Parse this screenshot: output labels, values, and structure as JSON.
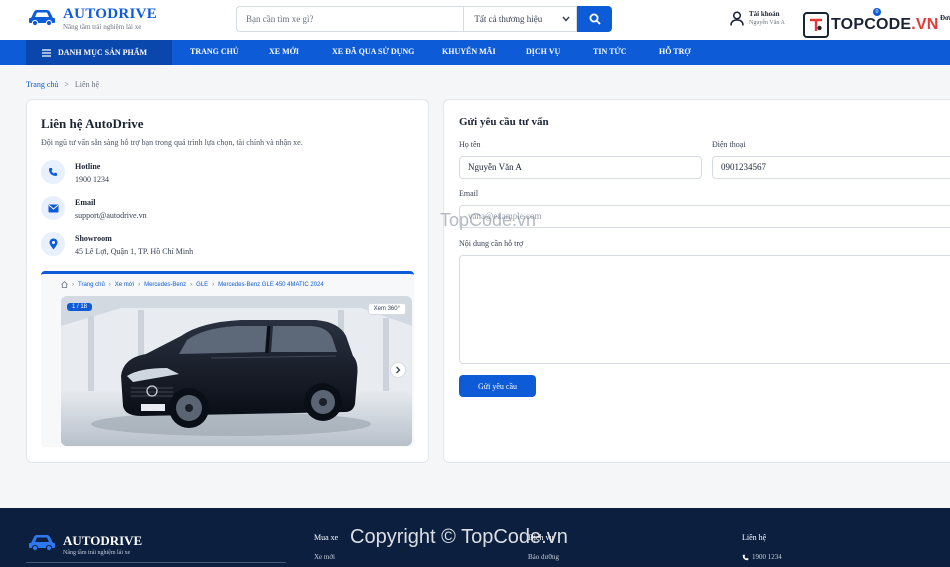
{
  "header": {
    "brand": "AUTODRIVE",
    "tagline": "Nâng tầm trải nghiệm lái xe",
    "search_placeholder": "Bạn cần tìm xe gì?",
    "brand_filter": "Tất cả thương hiệu",
    "account_label": "Tài khoản",
    "account_name": "Nguyễn Văn A",
    "cart_count": "0",
    "orders_label": "Đơn"
  },
  "watermark": {
    "logo_prefix": "TOPCODE",
    "logo_suffix": ".VN",
    "center": "TopCode.vn",
    "copyright": "Copyright © TopCode.vn"
  },
  "nav": {
    "category_label": "DANH MỤC SẢN PHẨM",
    "items": [
      "TRANG CHỦ",
      "XE MỚI",
      "XE ĐÃ QUA SỬ DỤNG",
      "KHUYẾN MÃI",
      "DỊCH VỤ",
      "TIN TỨC",
      "HỖ TRỢ"
    ]
  },
  "breadcrumb": {
    "home": "Trang chủ",
    "separator": ">",
    "current": "Liên hệ"
  },
  "contact": {
    "title": "Liên hệ AutoDrive",
    "description": "Đội ngũ tư vấn sẵn sàng hỗ trợ bạn trong quá trình lựa chọn, tài chính và nhận xe.",
    "items": [
      {
        "icon": "phone-icon",
        "label": "Hotline",
        "value": "1900 1234"
      },
      {
        "icon": "mail-icon",
        "label": "Email",
        "value": "support@autodrive.vn"
      },
      {
        "icon": "location-icon",
        "label": "Showroom",
        "value": "45 Lê Lợi, Quận 1, TP. Hồ Chí Minh"
      }
    ],
    "showcase": {
      "crumbs": [
        "Trang chủ",
        "Xe mới",
        "Mercedes-Benz",
        "GLE",
        "Mercedes-Benz GLE 450 4MATIC 2024"
      ],
      "counter": "1 / 18",
      "view360": "Xem 360°",
      "plate": "GLE"
    }
  },
  "form": {
    "title": "Gửi yêu cầu tư vấn",
    "name_label": "Họ tên",
    "name_value": "Nguyễn Văn A",
    "phone_label": "Điện thoại",
    "phone_value": "0901234567",
    "email_label": "Email",
    "email_value": "vana@example.com",
    "message_label": "Nội dung cần hỗ trợ",
    "submit_label": "Gửi yêu cầu"
  },
  "footer": {
    "brand": "AUTODRIVE",
    "tagline": "Nâng tầm trải nghiệm lái xe",
    "columns": [
      {
        "title": "Mua xe",
        "item": "Xe mới"
      },
      {
        "title": "Dịch vụ",
        "item": "Bảo dưỡng"
      },
      {
        "title": "Liên hệ",
        "item": "1900 1234"
      }
    ]
  },
  "colors": {
    "primary": "#0d5bd7",
    "nav_dark": "#0a47ad",
    "footer": "#0c1f3f"
  }
}
